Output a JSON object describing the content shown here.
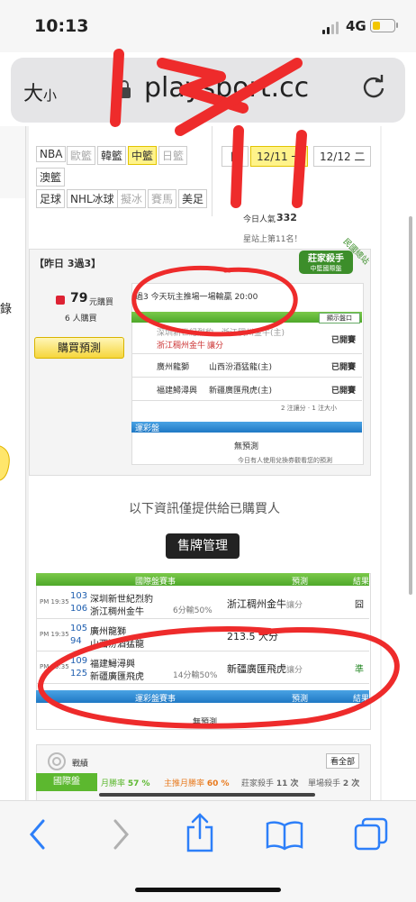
{
  "status_bar": {
    "time": "10:13",
    "network": "4G"
  },
  "browser": {
    "text_size_label": "大",
    "text_size_small": "小",
    "url": "playsport.cc"
  },
  "leagues": {
    "row1": [
      "NBA",
      "歐籃",
      "韓籃",
      "中籃",
      "日籃"
    ],
    "row2": [
      "澳籃"
    ],
    "row3": [
      "足球",
      "NHL冰球",
      "擬冰",
      "賽馬",
      "美足"
    ]
  },
  "dates": {
    "day1": "日",
    "selected": "12/11",
    "selected_suffix": "一",
    "next": "12/12",
    "next_suffix": "二"
  },
  "stats": {
    "popularity_label": "今日人氣",
    "popularity_value": "332",
    "rank_text": "星站上第11名！"
  },
  "badge": {
    "title": "莊家殺手",
    "subtitle": "中籃國際盤",
    "ribbon": "民國總站"
  },
  "left_side": {
    "record_label": "錄"
  },
  "predict_panel": {
    "header": "【昨日 3過3】",
    "price": "79",
    "price_unit": "元購買",
    "buyers": "6 人購買",
    "buy_button": "購買預測",
    "desc": "過3 今天玩主推場一場輸贏 20:00",
    "show_button": "顯示盤口",
    "rows": [
      {
        "team_a": "深圳新世紀烈豹",
        "team_b": "浙江稠州金牛(主)",
        "pick": "浙江稠州金牛",
        "pick_type": "讓分",
        "status": "已開賽"
      },
      {
        "team_a": "廣州龍獅",
        "team_b": "山西汾酒猛龍(主)",
        "status": "已開賽"
      },
      {
        "team_a": "福建鱘潯興",
        "team_b": "新疆廣匯飛虎(主)",
        "status": "已開賽"
      }
    ],
    "note1": "2 注讓分 · 1 注大小",
    "lottery_label": "運彩盤",
    "no_pick": "無預測",
    "footer_note": "今日有人使用兌換券觀看您的預測"
  },
  "notice": "以下資訊僅提供給已購買人",
  "sale_button": "售牌管理",
  "results": {
    "col_game": "國際盤賽事",
    "col_pick": "預測",
    "col_result": "結果",
    "rows": [
      {
        "time": "PM 19:35",
        "num1": "103",
        "team1": "深圳新世紀烈豹",
        "num2": "106",
        "team2": "浙江稠州金牛",
        "line": "6分輸50%",
        "pick": "浙江稠州金牛",
        "pick_type": "讓分",
        "result": "囧"
      },
      {
        "time": "PM 19:35",
        "num1": "105",
        "team1": "廣州龍獅",
        "num2": "94",
        "team2": "山西汾酒猛龍",
        "line": "",
        "pick": "213.5 大分",
        "pick_type": "",
        "result": ""
      },
      {
        "time": "PM 19:35",
        "num1": "109",
        "team1": "福建鱘潯興",
        "num2": "125",
        "team2": "新疆廣匯飛虎",
        "line": "14分輸50%",
        "pick": "新疆廣匯飛虎",
        "pick_type": "讓分",
        "result": "準"
      }
    ],
    "lottery_col_game": "運彩盤賽事",
    "lottery_col_pick": "預測",
    "lottery_col_result": "結果",
    "lottery_empty": "無預測"
  },
  "record": {
    "title": "戰績",
    "view_all": "看全部",
    "row1": [
      {
        "label": "國際盤",
        "value": ""
      },
      {
        "label": "月勝率",
        "value": "57 %"
      },
      {
        "label": "主推月勝率",
        "value": "60 %"
      },
      {
        "label": "莊家殺手",
        "value": "11 次"
      },
      {
        "label": "單場殺手",
        "value": "2 次"
      }
    ]
  },
  "colors": {
    "accent_green": "#5cb82f",
    "accent_blue": "#2a86d0",
    "annotation_red": "#ee2b2b",
    "highlight_yellow": "#fff38a"
  }
}
